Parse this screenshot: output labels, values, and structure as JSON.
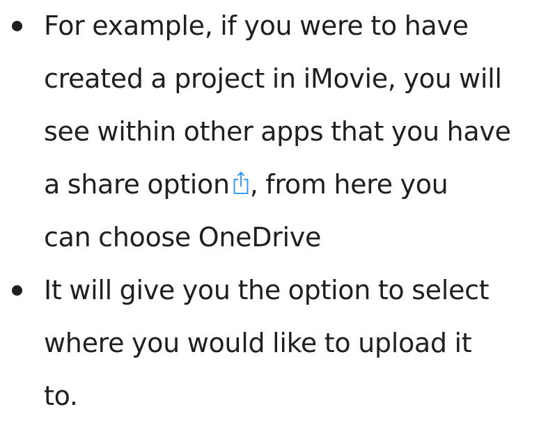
{
  "bullets": [
    {
      "lines": [
        "For example, if you were to have",
        "created a project in iMovie, you will",
        "see within other apps that you have"
      ],
      "line_before_icon": "a share option",
      "line_after_icon": ", from here you",
      "last_line": "can choose OneDrive",
      "icon": "share-icon",
      "icon_color": "#1e90ff"
    },
    {
      "lines": [
        "It will give you the option to select",
        "where you would like to upload it",
        "to."
      ]
    }
  ]
}
